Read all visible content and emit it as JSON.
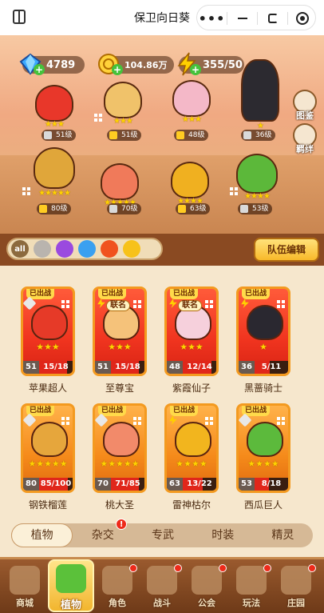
{
  "topbar": {
    "title": "保卫向日葵",
    "dots": "•••"
  },
  "resources": {
    "gems": "4789",
    "gold": "104.86万",
    "energy": "355/50"
  },
  "side_buttons": {
    "handbook": "图鉴",
    "bond": "羁绊"
  },
  "team": [
    {
      "level": "51级",
      "stars": "★★★",
      "color": "#e8372a"
    },
    {
      "level": "51级",
      "stars": "★★★",
      "color": "#f0c26a"
    },
    {
      "level": "48级",
      "stars": "★★★",
      "color": "#f4b8c8"
    },
    {
      "level": "36级",
      "stars": "★",
      "color": "#2c2a30"
    },
    {
      "level": "80级",
      "stars": "★★★★★",
      "color": "#e0a63a"
    },
    {
      "level": "70级",
      "stars": "★★★★★",
      "color": "#f07a5a"
    },
    {
      "level": "63级",
      "stars": "★★★★",
      "color": "#f0b020"
    },
    {
      "level": "53级",
      "stars": "★★★★",
      "color": "#5cb83a"
    }
  ],
  "filter": {
    "all_label": "all",
    "team_edit": "队伍编辑"
  },
  "cards": [
    {
      "name": "苹果超人",
      "tag": "已出战",
      "level": "51",
      "progress": "15/18",
      "fill": 0.83,
      "stars": "★★★",
      "color": "#e63a28",
      "style": "red",
      "badge": "sword"
    },
    {
      "name": "至尊宝",
      "tag": "已出战",
      "level": "51",
      "progress": "15/18",
      "fill": 0.83,
      "stars": "★★★",
      "color": "#f5c27a",
      "style": "red",
      "badge": "bolt",
      "union": "联名"
    },
    {
      "name": "紫霞仙子",
      "tag": "已出战",
      "level": "48",
      "progress": "12/14",
      "fill": 0.86,
      "stars": "★★★",
      "color": "#f6d0dc",
      "style": "red",
      "badge": "bolt",
      "union": "联名"
    },
    {
      "name": "黑蔷骑士",
      "tag": "已出战",
      "level": "36",
      "progress": "5/11",
      "fill": 0.45,
      "stars": "★",
      "color": "#2a2830",
      "style": "red",
      "badge": "bolt"
    },
    {
      "name": "钢铁榴莲",
      "tag": "已出战",
      "level": "80",
      "progress": "85/100",
      "fill": 0.85,
      "stars": "★★★★★",
      "color": "#e6a63c",
      "style": "orange",
      "badge": "sword"
    },
    {
      "name": "桃大圣",
      "tag": "已出战",
      "level": "70",
      "progress": "71/85",
      "fill": 0.84,
      "stars": "★★★★★",
      "color": "#f28a6a",
      "style": "orange",
      "badge": "sword"
    },
    {
      "name": "雷神枯尔",
      "tag": "已出战",
      "level": "63",
      "progress": "13/22",
      "fill": 0.59,
      "stars": "★★★★",
      "color": "#f2b51e",
      "style": "orange",
      "badge": "bolt"
    },
    {
      "name": "西瓜巨人",
      "tag": "已出战",
      "level": "53",
      "progress": "8/18",
      "fill": 0.44,
      "stars": "★★★★",
      "color": "#5cba3c",
      "style": "orange",
      "badge": "sword"
    }
  ],
  "tabs": [
    {
      "label": "植物"
    },
    {
      "label": "杂交",
      "badge": "!"
    },
    {
      "label": "专武"
    },
    {
      "label": "时装"
    },
    {
      "label": "精灵"
    }
  ],
  "nav": [
    {
      "label": "商城"
    },
    {
      "label": "植物"
    },
    {
      "label": "角色"
    },
    {
      "label": "战斗"
    },
    {
      "label": "公会"
    },
    {
      "label": "玩法"
    },
    {
      "label": "庄园"
    }
  ]
}
